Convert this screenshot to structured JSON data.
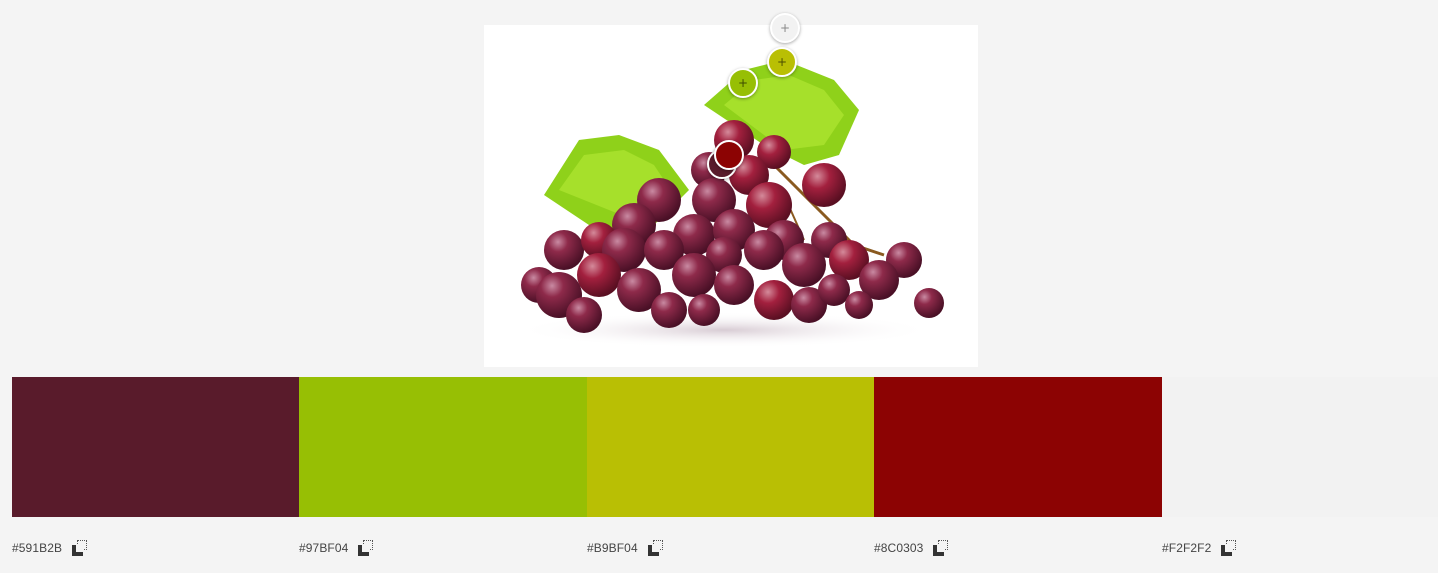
{
  "palette": [
    {
      "hex": "#591B2B",
      "color": "#591B2B"
    },
    {
      "hex": "#97BF04",
      "color": "#97BF04"
    },
    {
      "hex": "#B9BF04",
      "color": "#B9BF04"
    },
    {
      "hex": "#8C0303",
      "color": "#8C0303"
    },
    {
      "hex": "#F2F2F2",
      "color": "#F2F2F2"
    }
  ],
  "pickers": [
    {
      "color": "#F2F2F2",
      "icon": "plus-icon"
    },
    {
      "color": "#B9BF04",
      "icon": "plus-icon"
    },
    {
      "color": "#97BF04",
      "icon": "plus-icon"
    },
    {
      "color": "#8C0303"
    },
    {
      "color": "#591B2B"
    }
  ],
  "image": {
    "subject": "grapes-photo"
  },
  "icons": {
    "copy": "copy-icon",
    "picker": "plus-icon"
  },
  "glyphs": {
    "plus": "+"
  }
}
